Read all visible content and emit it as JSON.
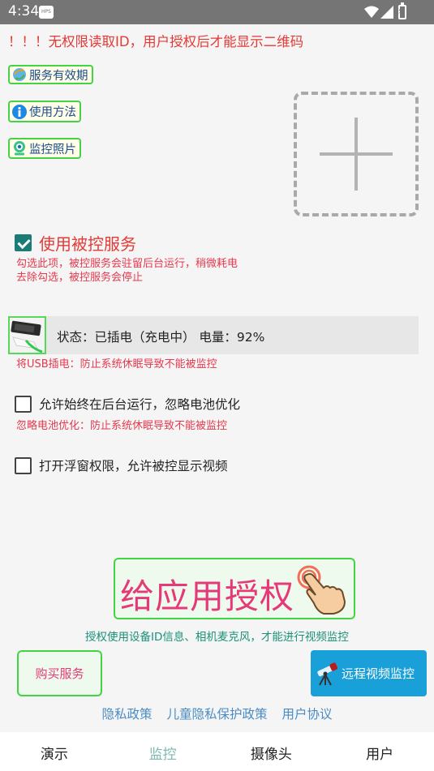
{
  "status_bar": {
    "time": "4:34",
    "notif_badge": "HPS"
  },
  "warning": "！！！无权限读取ID，用户授权后才能显示二维码",
  "buttons": {
    "service_validity": "服务有效期",
    "usage": "使用方法",
    "monitor_photos": "监控照片"
  },
  "controlled_service": {
    "label": "使用被控服务",
    "checked": true,
    "hint_line1": "勾选此项，被控服务会驻留后台运行，稍微耗电",
    "hint_line2": "去除勾选，被控服务会停止"
  },
  "power": {
    "status_text": "状态：已插电（充电中）  电量：92%",
    "hint": "将USB插电：防止系统休眠导致不能被监控"
  },
  "background_run": {
    "label": "允许始终在后台运行，忽略电池优化",
    "checked": false,
    "hint": "忽略电池优化：防止系统休眠导致不能被监控"
  },
  "float_window": {
    "label": "打开浮窗权限，允许被控显示视频",
    "checked": false
  },
  "authorize": {
    "label": "给应用授权",
    "hint": "授权使用设备ID信息、相机麦克风，才能进行视频监控"
  },
  "buy_service": "购买服务",
  "remote_video": "远程视频监控",
  "links": {
    "privacy": "隐私政策",
    "child_privacy": "儿童隐私保护政策",
    "user_agreement": "用户协议"
  },
  "tabs": [
    {
      "label": "演示"
    },
    {
      "label": "监控"
    },
    {
      "label": "摄像头"
    },
    {
      "label": "用户"
    }
  ],
  "active_tab": "监控",
  "colors": {
    "accent_green": "#43d343",
    "warning_red": "#e53935",
    "teal": "#1a7c77",
    "blue_button": "#1aa0d8"
  }
}
